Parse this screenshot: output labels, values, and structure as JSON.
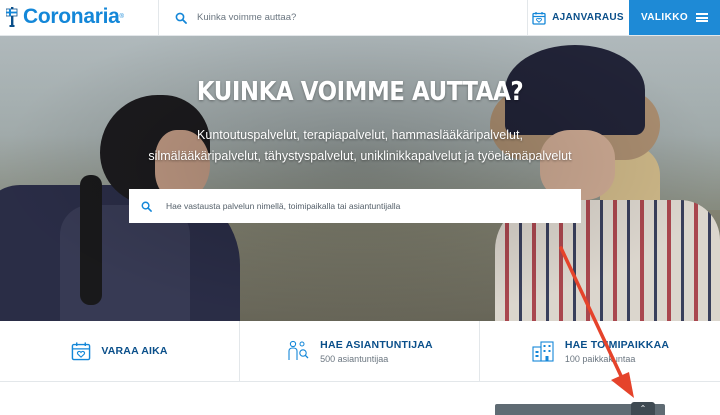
{
  "header": {
    "logo_text": "Coronaria",
    "logo_reg": "®",
    "search_placeholder": "Kuinka voimme auttaa?",
    "booking_label": "AJANVARAUS",
    "menu_label": "VALIKKO"
  },
  "hero": {
    "title": "KUINKA VOIMME AUTTAA?",
    "subtitle_line1": "Kuntoutuspalvelut, terapiapalvelut, hammaslääkäripalvelut,",
    "subtitle_line2": "silmälääkäripalvelut, tähystyspalvelut, uniklinikkapalvelut ja työelämäpalvelut",
    "search_placeholder": "Hae vastausta palvelun nimellä, toimipaikalla tai asiantuntijalla"
  },
  "quick_links": [
    {
      "label": "VARAA AIKA",
      "sub": "",
      "icon": "calendar-heart-icon"
    },
    {
      "label": "HAE ASIANTUNTIJAA",
      "sub": "500 asiantuntijaa",
      "icon": "people-search-icon"
    },
    {
      "label": "HAE TOIMIPAIKKAA",
      "sub": "100 paikkakuntaa",
      "icon": "building-icon"
    }
  ],
  "scroll_top_glyph": "⌃",
  "colors": {
    "brand": "#1487d8",
    "navy": "#0a4f8a",
    "menu_bg": "#1e8ad6",
    "annotation_arrow": "#e5432b"
  }
}
